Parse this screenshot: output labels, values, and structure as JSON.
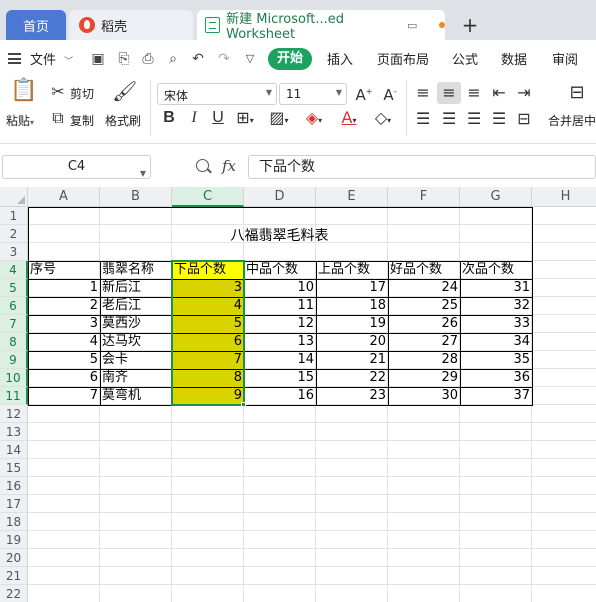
{
  "tabs": {
    "home": "首页",
    "daoke": "稻壳",
    "document": "新建 Microsoft...ed Worksheet",
    "new_tab": "+"
  },
  "menu": {
    "file": "文件",
    "start": "开始",
    "insert": "插入",
    "page_layout": "页面布局",
    "formula": "公式",
    "data": "数据",
    "review": "审阅"
  },
  "ribbon": {
    "paste": "粘贴",
    "cut": "剪切",
    "copy": "复制",
    "format_painter": "格式刷",
    "font_name": "宋体",
    "font_size": "11",
    "bold": "B",
    "italic": "I",
    "underline": "U",
    "merge_center": "合并居中"
  },
  "formula_bar": {
    "cell_ref": "C4",
    "fx": "fx",
    "content": "下品个数"
  },
  "grid": {
    "columns": [
      "A",
      "B",
      "C",
      "D",
      "E",
      "F",
      "G",
      "H"
    ],
    "rows": [
      "1",
      "2",
      "3",
      "4",
      "5",
      "6",
      "7",
      "8",
      "9",
      "10",
      "11",
      "12",
      "13",
      "14",
      "15",
      "16",
      "17",
      "18",
      "19",
      "20",
      "21",
      "22"
    ],
    "title": "八福翡翠毛料表",
    "headers": [
      "序号",
      "翡翠名称",
      "下品个数",
      "中品个数",
      "上品个数",
      "好品个数",
      "次品个数"
    ],
    "data": [
      [
        "1",
        "新后江",
        "3",
        "10",
        "17",
        "24",
        "31"
      ],
      [
        "2",
        "老后江",
        "4",
        "11",
        "18",
        "25",
        "32"
      ],
      [
        "3",
        "莫西沙",
        "5",
        "12",
        "19",
        "26",
        "33"
      ],
      [
        "4",
        "达马坎",
        "6",
        "13",
        "20",
        "27",
        "34"
      ],
      [
        "5",
        "会卡",
        "7",
        "14",
        "21",
        "28",
        "35"
      ],
      [
        "6",
        "南齐",
        "8",
        "15",
        "22",
        "29",
        "36"
      ],
      [
        "7",
        "莫弯机",
        "9",
        "16",
        "23",
        "30",
        "37"
      ]
    ]
  },
  "colors": {
    "accent_green": "#1aa260",
    "highlight_yellow": "#d9d400",
    "home_tab_blue": "#4a78d2"
  }
}
